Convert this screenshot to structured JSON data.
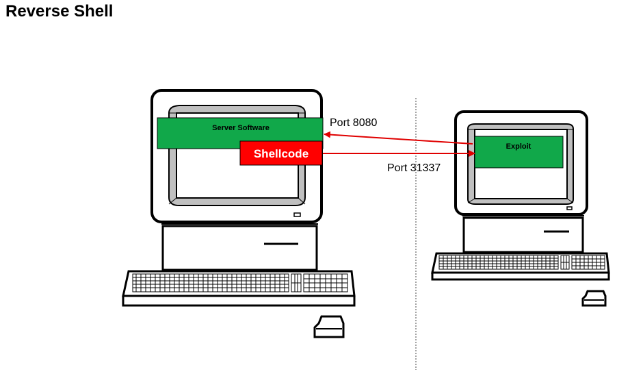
{
  "title": "Reverse Shell",
  "labels": {
    "server_software": "Server Software",
    "shellcode": "Shellcode",
    "exploit": "Exploit",
    "port_1": "Port 8080",
    "port_2": "Port 31337"
  },
  "colors": {
    "box_green": "#11a84a",
    "box_red": "#ff0000",
    "arrow": "#e00000",
    "screen_gray": "#c0c0c0"
  }
}
